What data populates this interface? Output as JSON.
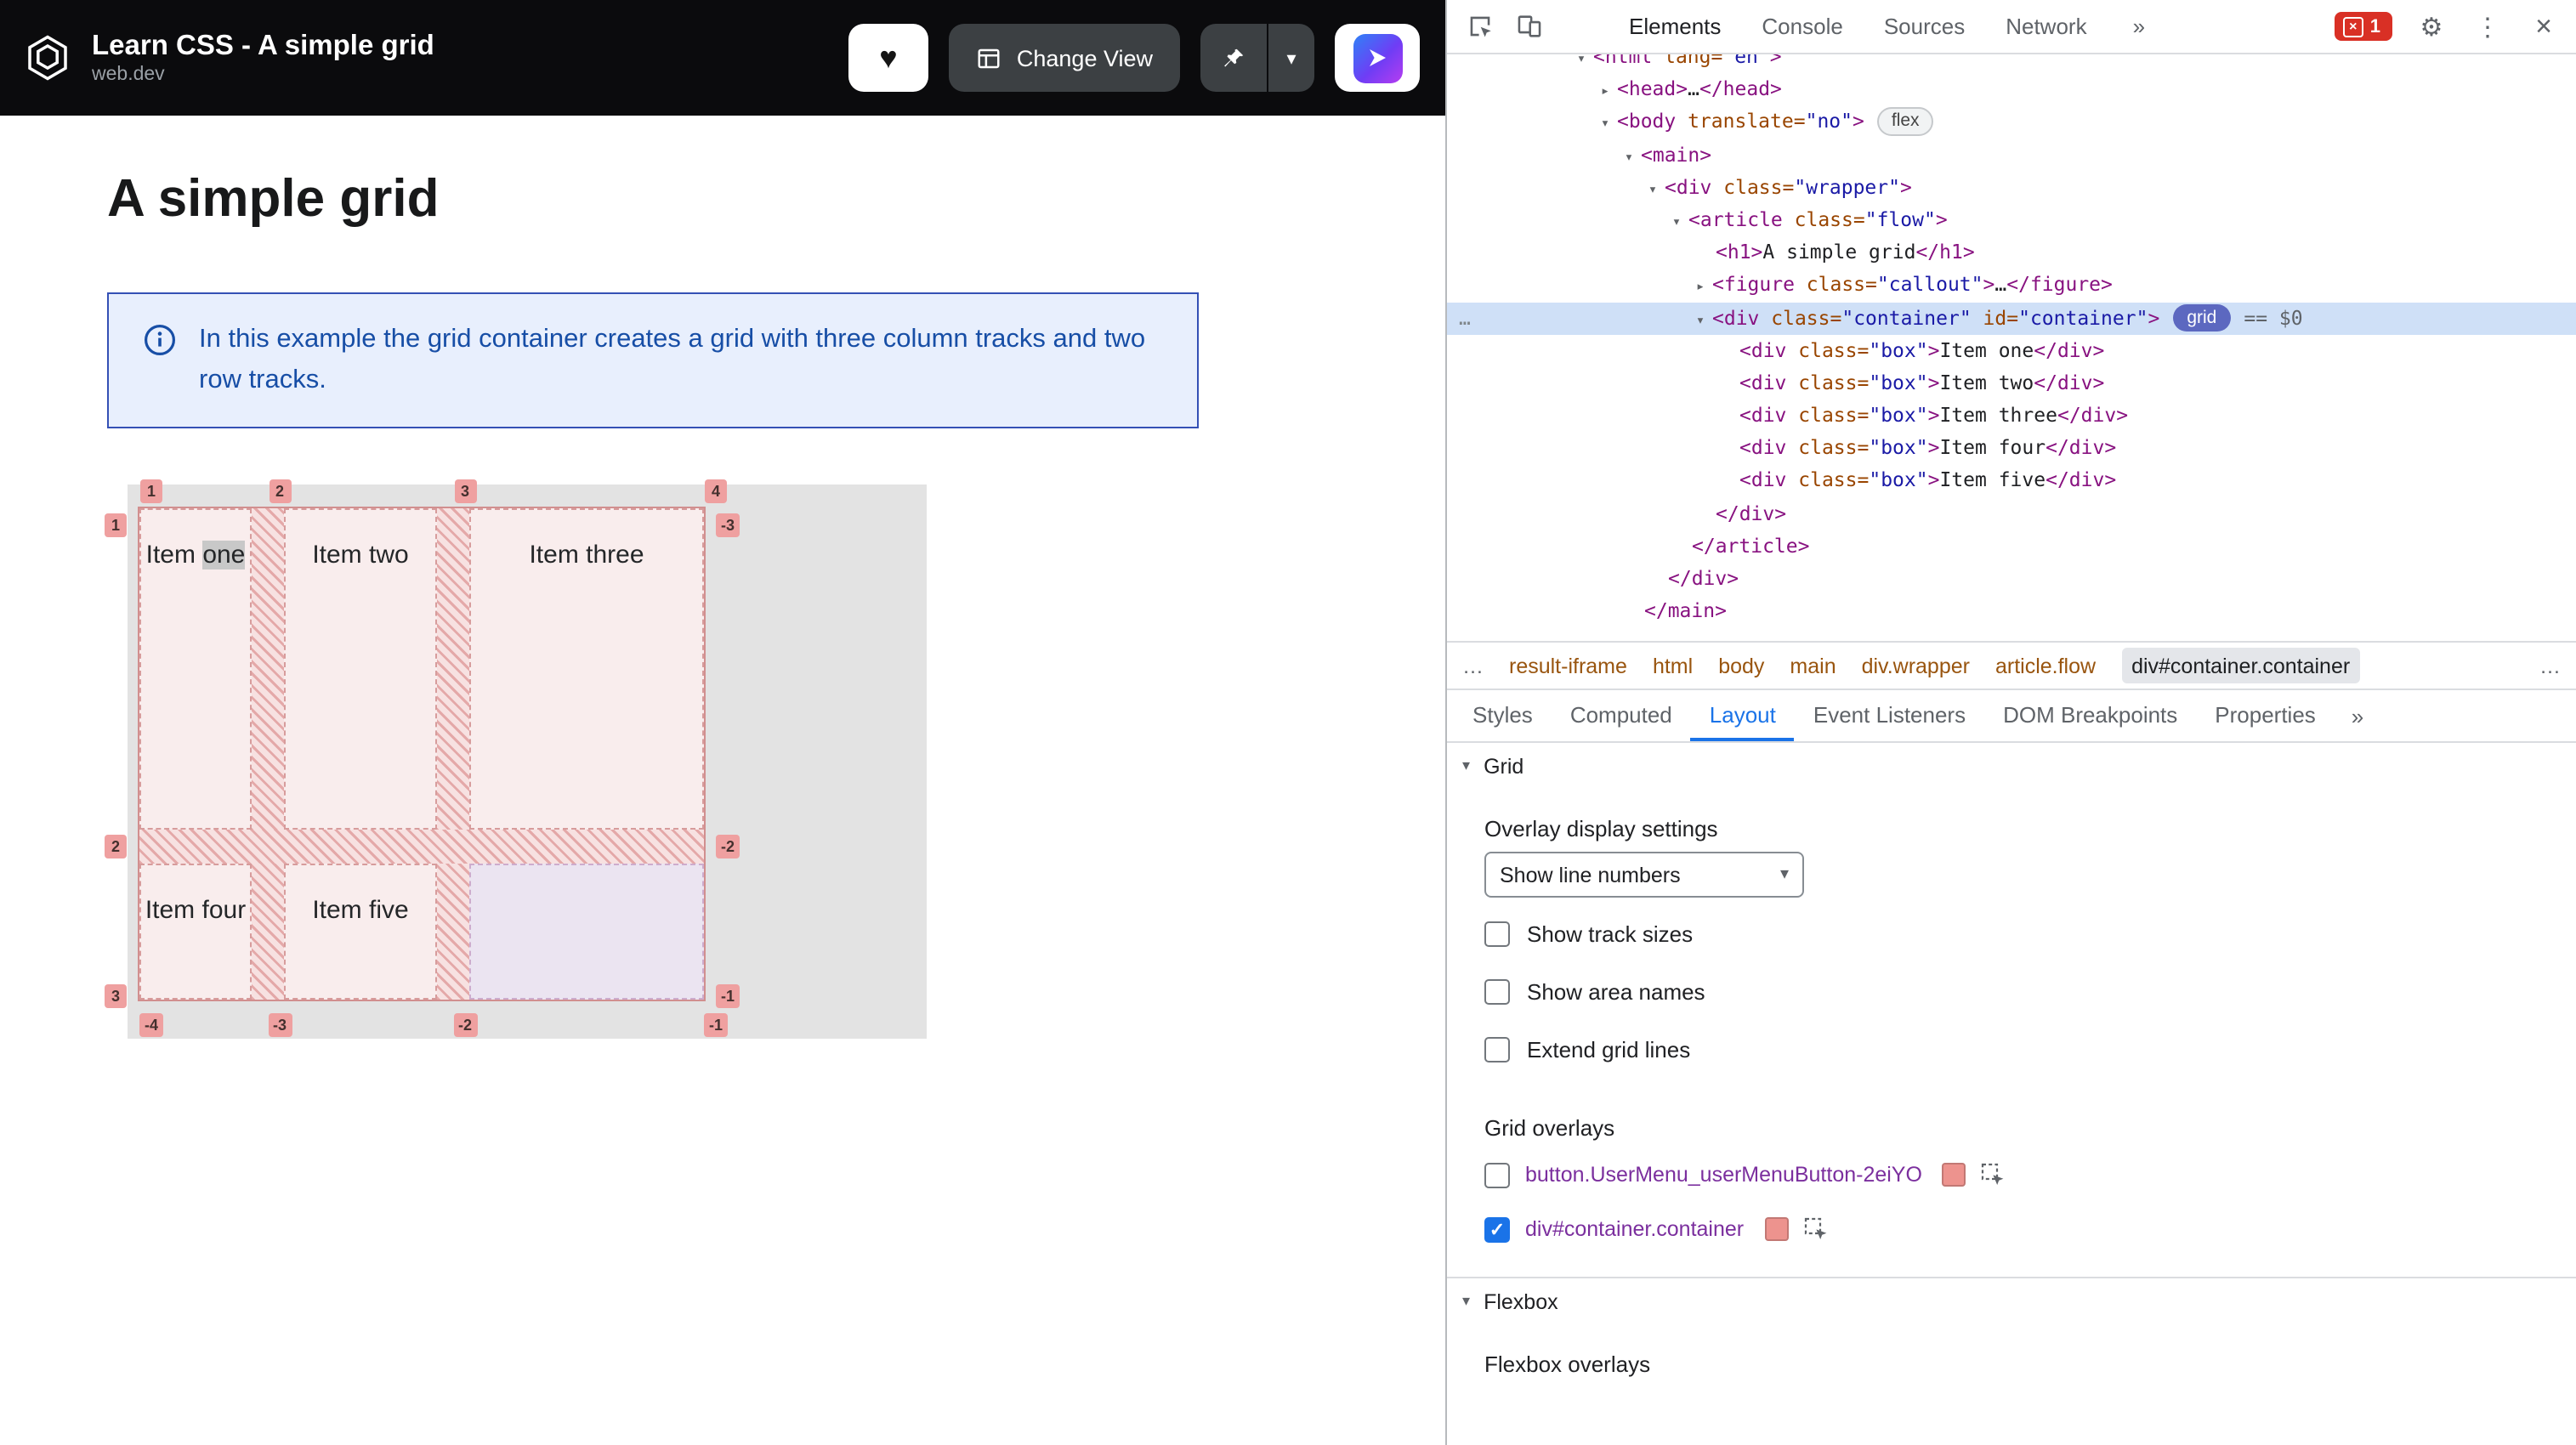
{
  "page": {
    "header": {
      "title": "Learn CSS - A simple grid",
      "subtitle": "web.dev",
      "change_view": "Change View"
    },
    "heading": "A simple grid",
    "callout_text": "In this example the grid container creates a grid with three column tracks and two row tracks.",
    "grid_demo": {
      "items": [
        "Item one",
        "Item two",
        "Item three",
        "Item four",
        "Item five"
      ],
      "top_labels": [
        "1",
        "2",
        "3",
        "4"
      ],
      "bottom_labels": [
        "-4",
        "-3",
        "-2",
        "-1"
      ],
      "left_labels": [
        "1",
        "2",
        "3"
      ],
      "right_labels": [
        "-3",
        "-2",
        "-1"
      ]
    }
  },
  "devtools": {
    "tabs": [
      "Elements",
      "Console",
      "Sources",
      "Network"
    ],
    "more_tabs_icon": "»",
    "error_count": "1",
    "badges": {
      "flex": "flex",
      "grid": "grid"
    },
    "dom_lines": [
      {
        "ind": 0,
        "arrow": "v",
        "toks": [
          [
            "g",
            "<html"
          ],
          [
            "a",
            " lang="
          ],
          [
            "v",
            "\"en\""
          ],
          [
            "g",
            ">"
          ]
        ]
      },
      {
        "ind": 1,
        "arrow": "r",
        "toks": [
          [
            "g",
            "<head>"
          ],
          [
            "t",
            "…"
          ],
          [
            "g",
            "</head>"
          ]
        ]
      },
      {
        "ind": 1,
        "arrow": "v",
        "toks": [
          [
            "g",
            "<body"
          ],
          [
            "a",
            " translate="
          ],
          [
            "v",
            "\"no\""
          ],
          [
            "g",
            ">"
          ]
        ],
        "badge": "flex"
      },
      {
        "ind": 2,
        "arrow": "v",
        "toks": [
          [
            "g",
            "<main>"
          ]
        ]
      },
      {
        "ind": 3,
        "arrow": "v",
        "toks": [
          [
            "g",
            "<div"
          ],
          [
            "a",
            " class="
          ],
          [
            "v",
            "\"wrapper\""
          ],
          [
            "g",
            ">"
          ]
        ]
      },
      {
        "ind": 4,
        "arrow": "v",
        "toks": [
          [
            "g",
            "<article"
          ],
          [
            "a",
            " class="
          ],
          [
            "v",
            "\"flow\""
          ],
          [
            "g",
            ">"
          ]
        ]
      },
      {
        "ind": 5,
        "toks": [
          [
            "g",
            "<h1>"
          ],
          [
            "t",
            "A simple grid"
          ],
          [
            "g",
            "</h1>"
          ]
        ]
      },
      {
        "ind": 5,
        "arrow": "r",
        "toks": [
          [
            "g",
            "<figure"
          ],
          [
            "a",
            " class="
          ],
          [
            "v",
            "\"callout\""
          ],
          [
            "g",
            ">"
          ],
          [
            "t",
            "…"
          ],
          [
            "g",
            "</figure>"
          ]
        ]
      },
      {
        "ind": 5,
        "arrow": "v",
        "sel": true,
        "gutter": "…",
        "toks": [
          [
            "g",
            "<div"
          ],
          [
            "a",
            " class="
          ],
          [
            "v",
            "\"container\""
          ],
          [
            "a",
            " id="
          ],
          [
            "v",
            "\"container\""
          ],
          [
            "g",
            ">"
          ]
        ],
        "badge": "grid",
        "suffix": "== $0"
      },
      {
        "ind": 6,
        "toks": [
          [
            "g",
            "<div"
          ],
          [
            "a",
            " class="
          ],
          [
            "v",
            "\"box\""
          ],
          [
            "g",
            ">"
          ],
          [
            "t",
            "Item one"
          ],
          [
            "g",
            "</div>"
          ]
        ]
      },
      {
        "ind": 6,
        "toks": [
          [
            "g",
            "<div"
          ],
          [
            "a",
            " class="
          ],
          [
            "v",
            "\"box\""
          ],
          [
            "g",
            ">"
          ],
          [
            "t",
            "Item two"
          ],
          [
            "g",
            "</div>"
          ]
        ]
      },
      {
        "ind": 6,
        "toks": [
          [
            "g",
            "<div"
          ],
          [
            "a",
            " class="
          ],
          [
            "v",
            "\"box\""
          ],
          [
            "g",
            ">"
          ],
          [
            "t",
            "Item three"
          ],
          [
            "g",
            "</div>"
          ]
        ]
      },
      {
        "ind": 6,
        "toks": [
          [
            "g",
            "<div"
          ],
          [
            "a",
            " class="
          ],
          [
            "v",
            "\"box\""
          ],
          [
            "g",
            ">"
          ],
          [
            "t",
            "Item four"
          ],
          [
            "g",
            "</div>"
          ]
        ]
      },
      {
        "ind": 6,
        "toks": [
          [
            "g",
            "<div"
          ],
          [
            "a",
            " class="
          ],
          [
            "v",
            "\"box\""
          ],
          [
            "g",
            ">"
          ],
          [
            "t",
            "Item five"
          ],
          [
            "g",
            "</div>"
          ]
        ]
      },
      {
        "ind": 5,
        "toks": [
          [
            "g",
            "</div>"
          ]
        ]
      },
      {
        "ind": 4,
        "toks": [
          [
            "g",
            "</article>"
          ]
        ]
      },
      {
        "ind": 3,
        "toks": [
          [
            "g",
            "</div>"
          ]
        ]
      },
      {
        "ind": 2,
        "toks": [
          [
            "g",
            "</main>"
          ]
        ]
      }
    ],
    "breadcrumbs": {
      "overflow": "…",
      "items": [
        "result-iframe",
        "html",
        "body",
        "main",
        "div.wrapper",
        "article.flow",
        "div#container.container"
      ],
      "current": "div#container.container"
    },
    "panel_tabs": [
      "Styles",
      "Computed",
      "Layout",
      "Event Listeners",
      "DOM Breakpoints",
      "Properties"
    ],
    "active_panel_tab": "Layout",
    "layout_panel": {
      "grid_section": "Grid",
      "overlay_settings_label": "Overlay display settings",
      "dropdown_value": "Show line numbers",
      "display_options": [
        "Show track sizes",
        "Show area names",
        "Extend grid lines"
      ],
      "grid_overlays_label": "Grid overlays",
      "overlays": [
        {
          "label": "button.UserMenu_userMenuButton-2eiYO",
          "checked": false
        },
        {
          "label": "div#container.container",
          "checked": true
        }
      ],
      "flexbox_section": "Flexbox",
      "flexbox_overlays_label": "Flexbox overlays"
    },
    "colors": {
      "accent": "#1a73e8",
      "overlay_pink": "#ed938e",
      "grid_badge": "#5c68c0"
    }
  }
}
